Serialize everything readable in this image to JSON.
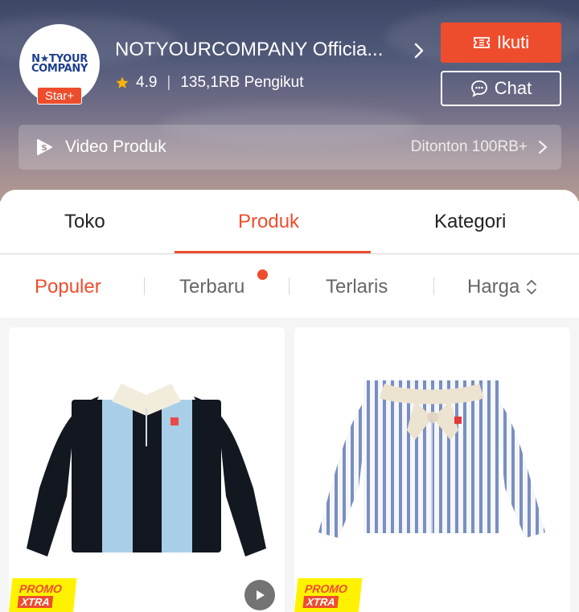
{
  "shop": {
    "logo_line1": "N★TYOUR",
    "logo_line2": "COMPANY",
    "badge": "Star+",
    "name": "NOTYOURCOMPANY Officia...",
    "rating": "4.9",
    "followers": "135,1RB Pengikut"
  },
  "actions": {
    "follow_label": "Ikuti",
    "chat_label": "Chat"
  },
  "video": {
    "label": "Video Produk",
    "views": "Ditonton 100RB+"
  },
  "tabs": [
    {
      "label": "Toko",
      "active": false
    },
    {
      "label": "Produk",
      "active": true
    },
    {
      "label": "Kategori",
      "active": false
    }
  ],
  "sort": [
    {
      "label": "Populer",
      "active": true
    },
    {
      "label": "Terbaru",
      "active": false,
      "new_dot": true
    },
    {
      "label": "Terlaris",
      "active": false
    },
    {
      "label": "Harga",
      "active": false
    }
  ],
  "products": [
    {
      "promo_line1": "PROMO",
      "promo_line2": "XTRA",
      "has_video": true,
      "item": "striped-rugby-polo-sweater"
    },
    {
      "promo_line1": "PROMO",
      "promo_line2": "XTRA",
      "has_video": false,
      "item": "striped-shirt-with-scarf"
    }
  ],
  "colors": {
    "accent": "#ee4d2d",
    "promo_yellow": "#fff200",
    "text_muted": "#666666"
  },
  "icons": {
    "rating": "star-icon",
    "follow": "ticket-icon",
    "chat": "chat-bubble-icon",
    "video": "shopee-video-icon",
    "sort_price": "up-down-chevron-icon",
    "play": "play-icon"
  }
}
